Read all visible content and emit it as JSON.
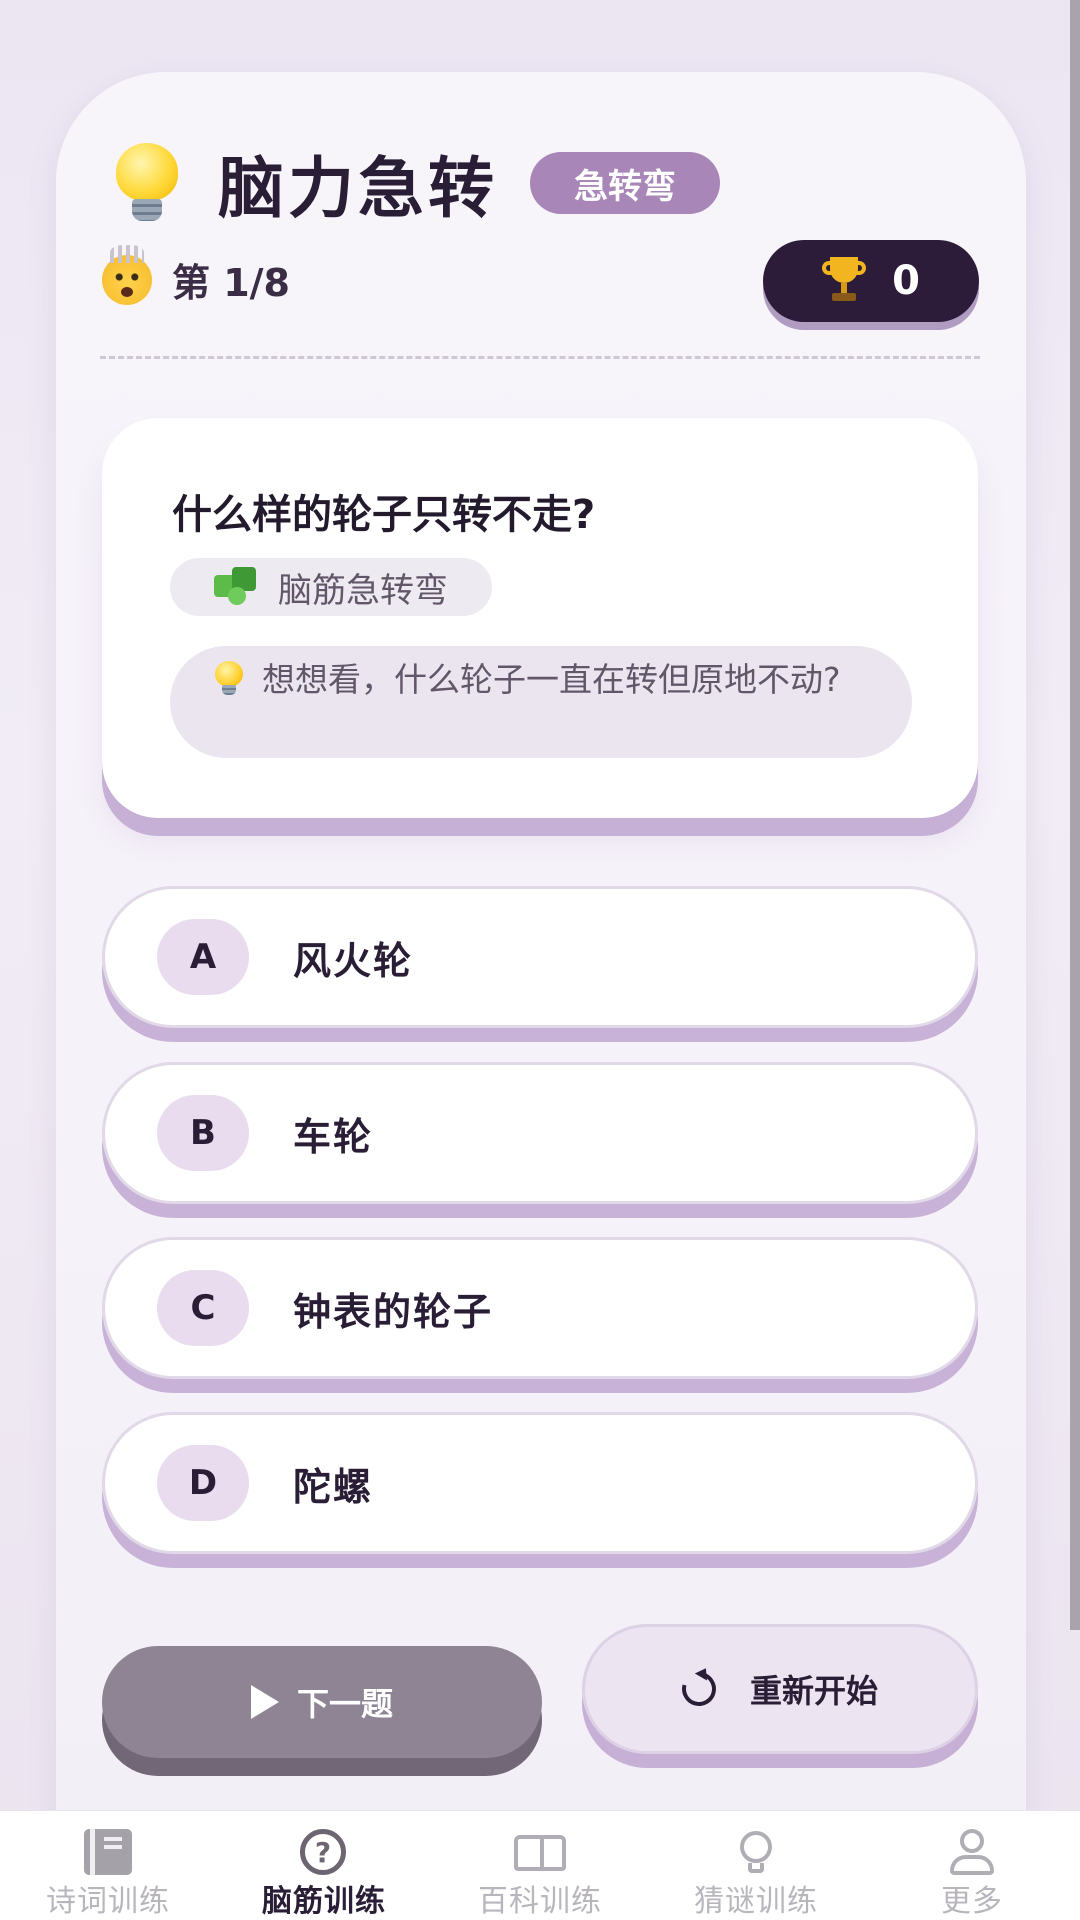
{
  "header": {
    "title": "脑力急转",
    "tag": "急转弯",
    "progress": "第 1/8",
    "score": "0"
  },
  "question": {
    "text": "什么样的轮子只转不走?",
    "category": "脑筋急转弯",
    "hint": "想想看，什么轮子一直在转但原地不动?"
  },
  "options": [
    {
      "letter": "A",
      "text": "风火轮"
    },
    {
      "letter": "B",
      "text": "车轮"
    },
    {
      "letter": "C",
      "text": "钟表的轮子"
    },
    {
      "letter": "D",
      "text": "陀螺"
    }
  ],
  "actions": {
    "next_label": "下一题",
    "restart_label": "重新开始"
  },
  "tabs": [
    {
      "label": "诗词训练",
      "icon": "book-icon",
      "active": false
    },
    {
      "label": "脑筋训练",
      "icon": "question-icon",
      "active": true
    },
    {
      "label": "百科训练",
      "icon": "open-book-icon",
      "active": false
    },
    {
      "label": "猜谜训练",
      "icon": "lightbulb-icon",
      "active": false
    },
    {
      "label": "更多",
      "icon": "person-icon",
      "active": false
    }
  ],
  "colors": {
    "accent": "#a886b8",
    "dark": "#2c1c3a",
    "next_button": "#8e8493"
  }
}
